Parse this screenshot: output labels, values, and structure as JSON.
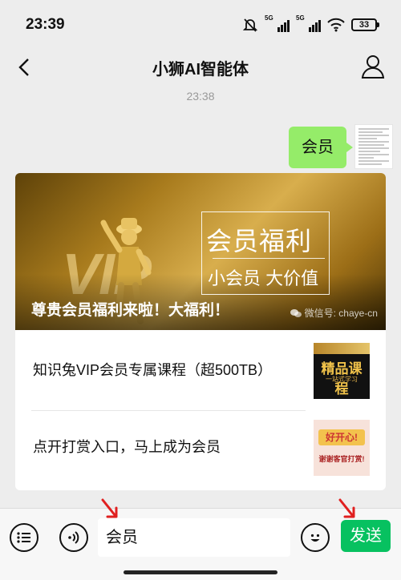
{
  "status_bar": {
    "time": "23:39",
    "network_label_1": "5G",
    "network_label_2": "5G",
    "battery": "33"
  },
  "nav": {
    "title": "小狮AI智能体"
  },
  "chat": {
    "timestamp": "23:38",
    "sent_message": "会员"
  },
  "card": {
    "cover": {
      "promo_title": "会员福利",
      "promo_subtitle": "小会员 大价值",
      "decor_text": "VIP",
      "headline": "尊贵会员福利来啦！大福利！",
      "watermark": "微信号: chaye-cn"
    },
    "items": [
      {
        "title": "知识兔VIP会员专属课程（超500TB）",
        "thumb_text": "精品课程",
        "thumb_sub": "一站式学习"
      },
      {
        "title": "点开打赏入口，马上成为会员",
        "thumb_text": "好开心!",
        "thumb_sub": "谢谢客官打赏!"
      }
    ]
  },
  "input_bar": {
    "value": "会员",
    "send_label": "发送"
  },
  "colors": {
    "accent": "#07c160",
    "bubble": "#95ec69",
    "annotation_arrow": "#e02020"
  },
  "icons": [
    "back-icon",
    "profile-icon",
    "muted-bell-icon",
    "signal-icon",
    "wifi-icon",
    "battery-icon",
    "menu-list-icon",
    "voice-icon",
    "emoji-icon",
    "arrow-annotation-icon"
  ]
}
